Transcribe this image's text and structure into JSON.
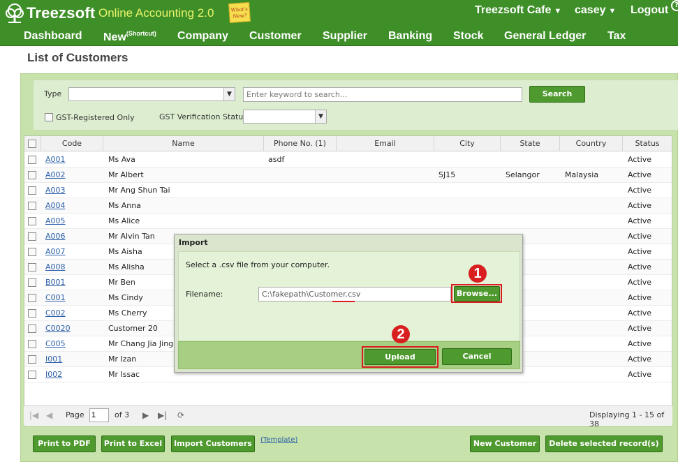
{
  "header": {
    "brand": "Treezsoft",
    "tagline": "Online Accounting 2.0",
    "whats_new": "What's New?",
    "company": "Treezsoft Cafe",
    "user": "casey",
    "logout": "Logout"
  },
  "menu": {
    "items": [
      "Dashboard",
      "New",
      "Company",
      "Customer",
      "Supplier",
      "Banking",
      "Stock",
      "General Ledger",
      "Tax"
    ],
    "new_suffix": "(Shortcut)"
  },
  "page": {
    "title": "List of Customers"
  },
  "filters": {
    "type_label": "Type",
    "type_value": "",
    "search_placeholder": "Enter keyword to search...",
    "search_button": "Search",
    "gst_only_label": "GST-Registered Only",
    "gst_status_label": "GST Verification Status",
    "gst_status_value": ""
  },
  "grid": {
    "columns": [
      "Code",
      "Name",
      "Phone No. (1)",
      "Email",
      "City",
      "State",
      "Country",
      "Status"
    ],
    "rows": [
      {
        "code": "A001",
        "name": "Ms Ava",
        "phone": "asdf",
        "email": "",
        "city": "",
        "state": "",
        "country": "",
        "status": "Active"
      },
      {
        "code": "A002",
        "name": "Mr Albert",
        "phone": "",
        "email": "",
        "city": "SJ15",
        "state": "Selangor",
        "country": "Malaysia",
        "status": "Active"
      },
      {
        "code": "A003",
        "name": "Mr Ang Shun Tai",
        "phone": "",
        "email": "",
        "city": "",
        "state": "",
        "country": "",
        "status": "Active"
      },
      {
        "code": "A004",
        "name": "Ms Anna",
        "phone": "",
        "email": "",
        "city": "",
        "state": "",
        "country": "",
        "status": "Active"
      },
      {
        "code": "A005",
        "name": "Ms Alice",
        "phone": "",
        "email": "",
        "city": "",
        "state": "",
        "country": "",
        "status": "Active"
      },
      {
        "code": "A006",
        "name": "Mr Alvin Tan",
        "phone": "",
        "email": "",
        "city": "",
        "state": "",
        "country": "",
        "status": "Active"
      },
      {
        "code": "A007",
        "name": "Ms Aisha",
        "phone": "",
        "email": "",
        "city": "",
        "state": "",
        "country": "",
        "status": "Active"
      },
      {
        "code": "A008",
        "name": "Ms Alisha",
        "phone": "",
        "email": "",
        "city": "",
        "state": "",
        "country": "",
        "status": "Active"
      },
      {
        "code": "B001",
        "name": "Mr Ben",
        "phone": "",
        "email": "",
        "city": "",
        "state": "",
        "country": "",
        "status": "Active"
      },
      {
        "code": "C001",
        "name": "Ms Cindy",
        "phone": "",
        "email": "",
        "city": "",
        "state": "",
        "country": "",
        "status": "Active"
      },
      {
        "code": "C002",
        "name": "Ms Cherry",
        "phone": "",
        "email": "",
        "city": "",
        "state": "",
        "country": "",
        "status": "Active"
      },
      {
        "code": "C0020",
        "name": "Customer 20",
        "phone": "",
        "email": "",
        "city": "",
        "state": "",
        "country": "",
        "status": "Active"
      },
      {
        "code": "C005",
        "name": "Mr Chang Jia Jing",
        "phone": "",
        "email": "",
        "city": "",
        "state": "",
        "country": "",
        "status": "Active"
      },
      {
        "code": "I001",
        "name": "Mr Izan",
        "phone": "",
        "email": "",
        "city": "",
        "state": "",
        "country": "",
        "status": "Active"
      },
      {
        "code": "I002",
        "name": "Mr Issac",
        "phone": "",
        "email": "",
        "city": "",
        "state": "",
        "country": "",
        "status": "Active"
      }
    ]
  },
  "pager": {
    "page_label": "Page",
    "page_value": "1",
    "of_label": "of 3",
    "displaying": "Displaying 1 - 15 of 38"
  },
  "actions": {
    "print_pdf": "Print to PDF",
    "print_excel": "Print to Excel",
    "import_customers": "Import Customers",
    "template": "(Template)",
    "new_customer": "New Customer",
    "delete_selected": "Delete selected record(s)"
  },
  "dialog": {
    "title": "Import",
    "instruction": "Select a .csv file from your computer.",
    "filename_label": "Filename:",
    "filename_value": "C:\\fakepath\\Customer.csv",
    "browse": "Browse...",
    "upload": "Upload",
    "cancel": "Cancel",
    "step1": "1",
    "step2": "2"
  },
  "colors": {
    "brand_green": "#3f8f29",
    "button_green": "#4f9a2f",
    "panel_green": "#c7e2ab",
    "link_blue": "#2b5fa8",
    "highlight_red": "#d81e1e",
    "tagline_yellow": "#e9f46a"
  },
  "icons": [
    "tree-logo-icon",
    "dropdown-caret-icon",
    "checkbox-icon",
    "first-page-icon",
    "prev-page-icon",
    "next-page-icon",
    "last-page-icon",
    "refresh-icon"
  ]
}
